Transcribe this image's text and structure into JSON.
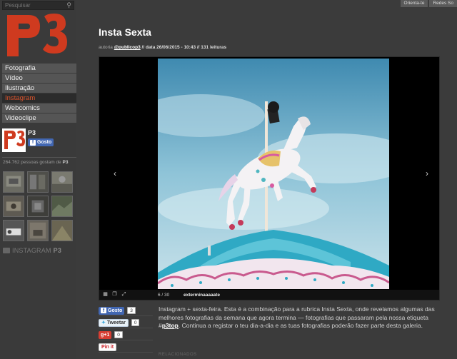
{
  "search": {
    "placeholder": "Pesquisar",
    "icon": "search-icon"
  },
  "logo": {
    "text": "P3",
    "color": "#cf3a1f"
  },
  "nav": {
    "items": [
      {
        "label": "Fotografia",
        "active": false
      },
      {
        "label": "Vídeo",
        "active": false
      },
      {
        "label": "Ilustração",
        "active": false
      },
      {
        "label": "Instagram",
        "active": true
      },
      {
        "label": "Webcomics",
        "active": false
      },
      {
        "label": "Videoclipe",
        "active": false
      }
    ]
  },
  "facebook": {
    "page_name": "P3",
    "like_label": "Gosto",
    "count_text": "264.762 pessoas gostam de",
    "count_page": "P3"
  },
  "instagram": {
    "label_prefix": "INSTAGRAM",
    "label_brand": "P3"
  },
  "top_tabs": [
    "Orienta-te",
    "Redes So"
  ],
  "article": {
    "title": "Insta Sexta",
    "meta_author_prefix": "autoria",
    "meta_author": "@publicop3",
    "meta_rest": "// data 26/06/2015 - 10:43 // 131 leituras",
    "body_before_tag": "Instagram + sexta-feira. Esta é a combinação para a rubrica Insta Sexta, onde revelamos algumas das melhores fotografias da semana que agora termina — fotografias que passaram pela nossa etiqueta #",
    "body_tag": "p3top",
    "body_after_tag": ". Continua a registar o teu dia-a-dia e as tuas fotografias poderão fazer parte desta galeria.",
    "related_label": "RELACIONADOS"
  },
  "viewer": {
    "counter": "6 / 30",
    "caption": "exterminaaaaate",
    "prev_icon": "chevron-left-icon",
    "next_icon": "chevron-right-icon"
  },
  "social": {
    "facebook_label": "Gosto",
    "facebook_count": "3",
    "tweet_label": "Tweetar",
    "tweet_count": "0",
    "gplus_label": "g+1",
    "gplus_count": "0",
    "pinterest_label": "Pin it"
  }
}
